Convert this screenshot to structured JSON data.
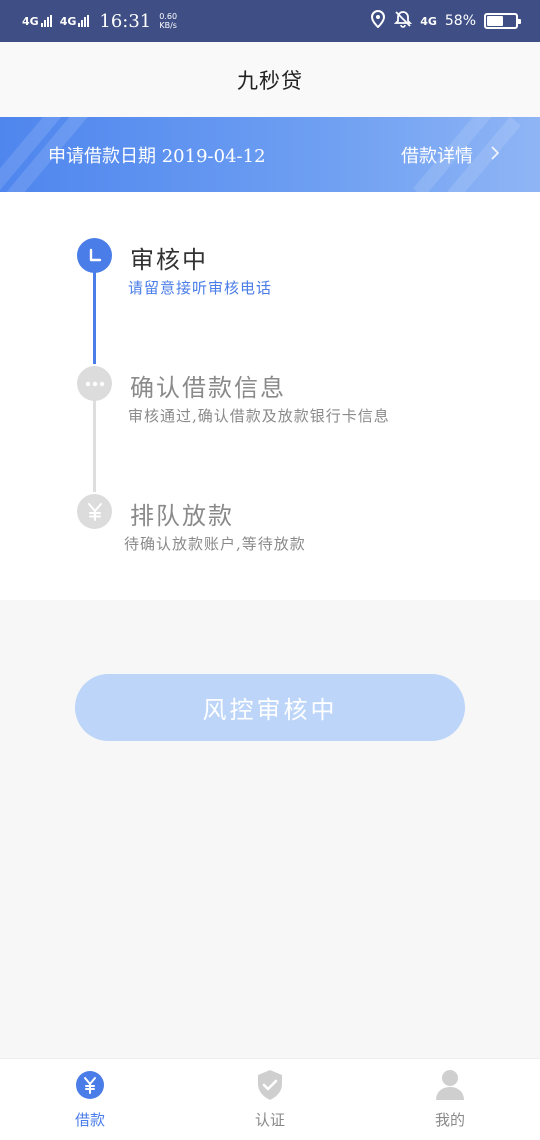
{
  "status_bar": {
    "network1": "4G",
    "network2": "4G",
    "time": "16:31",
    "speed_value": "0.60",
    "speed_unit": "KB/s",
    "network3": "4G",
    "battery_text": "58%",
    "battery_level": 0.58
  },
  "header": {
    "title": "九秒贷"
  },
  "banner": {
    "apply_label": "申请借款日期",
    "apply_date": "2019-04-12",
    "detail_label": "借款详情"
  },
  "steps": [
    {
      "title": "审核中",
      "subtitle": "请留意接听审核电话",
      "state": "active",
      "icon": "clock-icon"
    },
    {
      "title": "确认借款信息",
      "subtitle": "审核通过,确认借款及放款银行卡信息",
      "state": "pending",
      "icon": "dots-icon"
    },
    {
      "title": "排队放款",
      "subtitle": "待确认放款账户,等待放款",
      "state": "pending",
      "icon": "yen-icon"
    }
  ],
  "action_button": {
    "label": "风控审核中"
  },
  "bottom_nav": [
    {
      "label": "借款",
      "icon": "yen-circle-icon",
      "active": true
    },
    {
      "label": "认证",
      "icon": "shield-check-icon",
      "active": false
    },
    {
      "label": "我的",
      "icon": "person-icon",
      "active": false
    }
  ],
  "colors": {
    "primary": "#4a7de8",
    "banner_start": "#4f86ee",
    "banner_end": "#8fb5f5",
    "inactive_gray": "#dcdcdc",
    "button_disabled": "#bcd5f8",
    "subtitle_active": "#4a7de8",
    "text_gray": "#8a8a8a"
  }
}
